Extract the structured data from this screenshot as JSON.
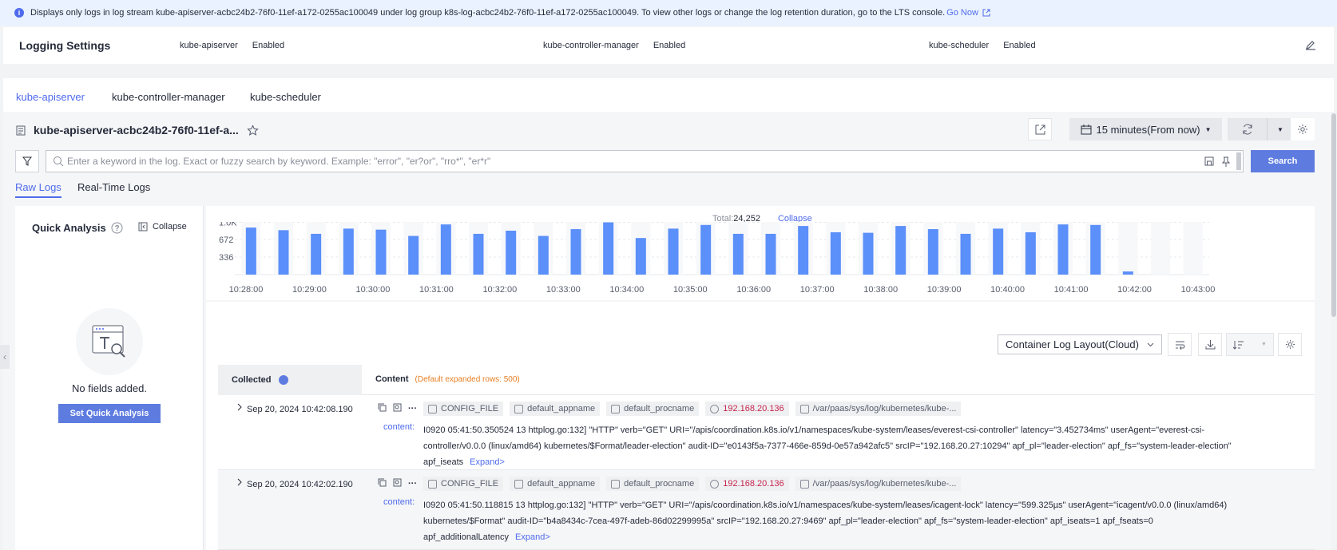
{
  "banner": {
    "text": "Displays only logs in log stream kube-apiserver-acbc24b2-76f0-11ef-a172-0255ac100049 under log group k8s-log-acbc24b2-76f0-11ef-a172-0255ac100049. To view other logs or change the log retention duration, go to the LTS console.",
    "link": "Go Now"
  },
  "settings": {
    "title": "Logging Settings",
    "components": [
      {
        "name": "kube-apiserver",
        "status": "Enabled"
      },
      {
        "name": "kube-controller-manager",
        "status": "Enabled"
      },
      {
        "name": "kube-scheduler",
        "status": "Enabled"
      }
    ]
  },
  "tabs": [
    "kube-apiserver",
    "kube-controller-manager",
    "kube-scheduler"
  ],
  "stream": {
    "title": "kube-apiserver-acbc24b2-76f0-11ef-a...",
    "time_range": "15 minutes(From now)"
  },
  "search": {
    "placeholder": "Enter a keyword in the log. Exact or fuzzy search by keyword. Example: \"error\", \"er?or\", \"rro*\", \"er*r\"",
    "button": "Search"
  },
  "subtabs": [
    "Raw Logs",
    "Real-Time Logs"
  ],
  "quick_analysis": {
    "title": "Quick Analysis",
    "collapse": "Collapse",
    "empty": "No fields added.",
    "button": "Set Quick Analysis"
  },
  "histogram": {
    "total_label": "Total:",
    "total_value": "24,252",
    "collapse": "Collapse"
  },
  "chart_data": {
    "type": "bar",
    "y_ticks": [
      "1.0K",
      "672",
      "336"
    ],
    "ylim": [
      0,
      1008
    ],
    "x_ticks": [
      "10:28:00",
      "10:29:00",
      "10:30:00",
      "10:31:00",
      "10:32:00",
      "10:33:00",
      "10:34:00",
      "10:35:00",
      "10:36:00",
      "10:37:00",
      "10:38:00",
      "10:39:00",
      "10:40:00",
      "10:41:00",
      "10:42:00",
      "10:43:00"
    ],
    "values": [
      900,
      850,
      780,
      880,
      860,
      740,
      960,
      780,
      840,
      740,
      870,
      1000,
      700,
      880,
      950,
      780,
      780,
      930,
      810,
      800,
      930,
      870,
      780,
      880,
      810,
      960,
      950,
      60,
      0,
      0
    ]
  },
  "log_layout": "Container Log Layout(Cloud)",
  "table": {
    "col_collected": "Collected",
    "col_content": "Content",
    "expanded_note": "(Default expanded rows: 500)",
    "content_label": "content:",
    "expand": "Expand>",
    "tags": [
      "CONFIG_FILE",
      "default_appname",
      "default_procname",
      "192.168.20.136",
      "/var/paas/sys/log/kubernetes/kube-..."
    ],
    "rows": [
      {
        "time": "Sep 20, 2024 10:42:08.190",
        "content": "I0920 05:41:50.350524 13 httplog.go:132] \"HTTP\" verb=\"GET\" URI=\"/apis/coordination.k8s.io/v1/namespaces/kube-system/leases/everest-csi-controller\" latency=\"3.452734ms\" userAgent=\"everest-csi-controller/v0.0.0 (linux/amd64) kubernetes/$Format/leader-election\" audit-ID=\"e0143f5a-7377-466e-859d-0e57a942afc5\" srcIP=\"192.168.20.27:10294\" apf_pl=\"leader-election\" apf_fs=\"system-leader-election\" apf_iseats"
      },
      {
        "time": "Sep 20, 2024 10:42:02.190",
        "content": "I0920 05:41:50.118815 13 httplog.go:132] \"HTTP\" verb=\"GET\" URI=\"/apis/coordination.k8s.io/v1/namespaces/kube-system/leases/icagent-lock\" latency=\"599.325µs\" userAgent=\"icagent/v0.0.0 (linux/amd64) kubernetes/$Format\" audit-ID=\"b4a8434c-7cea-497f-adeb-86d02299995a\" srcIP=\"192.168.20.27:9469\" apf_pl=\"leader-election\" apf_fs=\"system-leader-election\" apf_iseats=1 apf_fseats=0 apf_additionalLatency"
      }
    ]
  }
}
